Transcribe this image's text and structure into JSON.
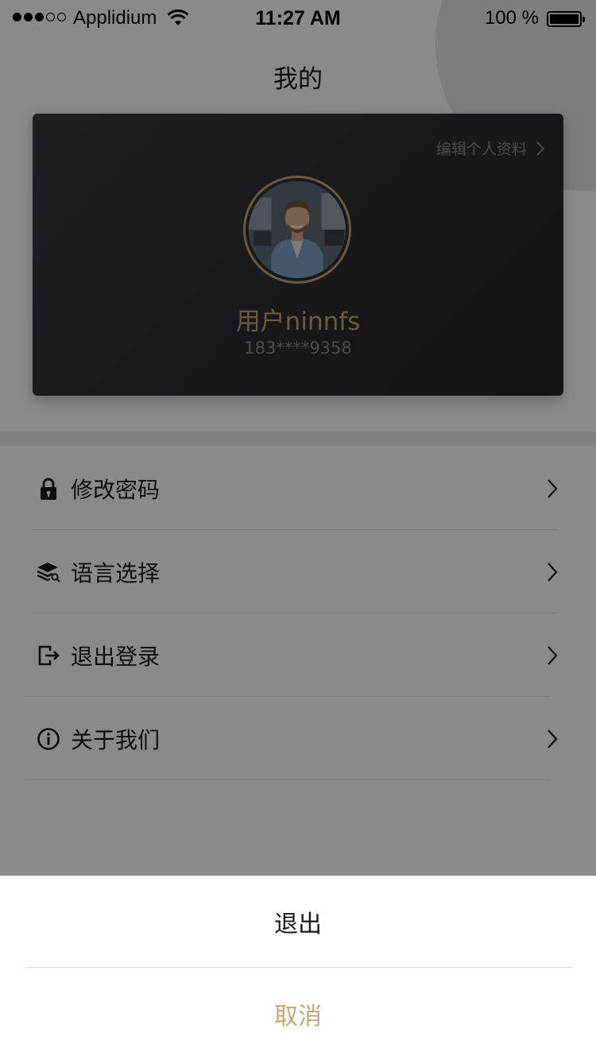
{
  "status_bar": {
    "carrier": "Applidium",
    "time": "11:27 AM",
    "battery_text": "100 %",
    "signal_bars_filled": 3,
    "signal_bars_total": 5,
    "battery_level": 1.0
  },
  "page": {
    "title": "我的"
  },
  "profile": {
    "edit_label": "编辑个人资料",
    "name": "用户ninnfs",
    "phone": "183****9358",
    "accent_color": "#c8a57a"
  },
  "menu": {
    "items": [
      {
        "label": "修改密码",
        "icon": "lock-icon"
      },
      {
        "label": "语言选择",
        "icon": "layers-search-icon"
      },
      {
        "label": "退出登录",
        "icon": "logout-icon"
      },
      {
        "label": "关于我们",
        "icon": "info-icon"
      }
    ]
  },
  "action_sheet": {
    "confirm_label": "退出",
    "cancel_label": "取消"
  }
}
